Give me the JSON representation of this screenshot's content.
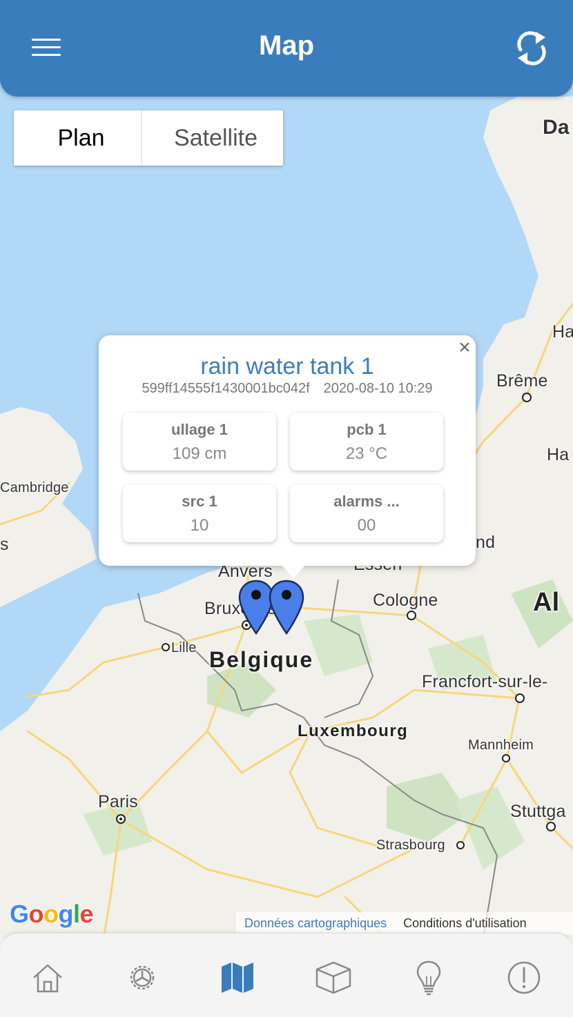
{
  "header": {
    "title": "Map",
    "menu_icon": "hamburger-menu-icon",
    "refresh_icon": "refresh-icon",
    "background_color": "#3a7dbd"
  },
  "map_type": {
    "options": [
      "Plan",
      "Satellite"
    ],
    "selected": "Plan"
  },
  "map_labels": {
    "cities": [
      "Brême",
      "Bruxelles",
      "Lille",
      "Anvers",
      "Essen",
      "Cologne",
      "Francfort-sur-le-",
      "Mannheim",
      "Paris",
      "Strasbourg",
      "Stuttga",
      "Cambridge",
      "Luxembourg",
      "Da",
      "Ha",
      "Ha",
      "nd",
      "s"
    ],
    "countries": [
      "Belgique",
      "Al"
    ]
  },
  "popup": {
    "title": "rain water tank 1",
    "device_id": "599ff14555f1430001bc042f",
    "timestamp": "2020-08-10 10:29",
    "close_icon": "close-icon",
    "readings": [
      {
        "label": "ullage 1",
        "value": "109 cm"
      },
      {
        "label": "pcb 1",
        "value": "23 °C"
      },
      {
        "label": "src 1",
        "value": "10"
      },
      {
        "label": "alarms ...",
        "value": "00"
      }
    ]
  },
  "markers": {
    "count": 2,
    "color": "#4a7ee8",
    "icon": "map-pin-icon"
  },
  "attribution": {
    "logo": "Google",
    "map_data": "Données cartographiques",
    "terms": "Conditions d'utilisation"
  },
  "bottom_nav": {
    "items": [
      {
        "icon": "home-icon",
        "active": false
      },
      {
        "icon": "settings-gear-icon",
        "active": false
      },
      {
        "icon": "map-icon",
        "active": true
      },
      {
        "icon": "cube-icon",
        "active": false
      },
      {
        "icon": "lightbulb-icon",
        "active": false
      },
      {
        "icon": "alert-icon",
        "active": false
      }
    ],
    "active_color": "#3a7dbd",
    "inactive_color": "#888888"
  }
}
